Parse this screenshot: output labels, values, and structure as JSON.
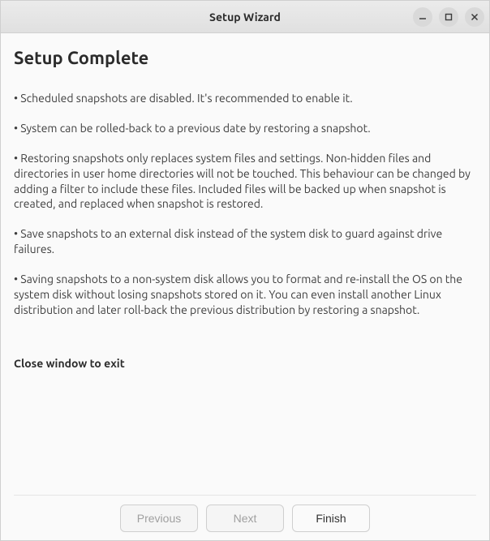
{
  "window": {
    "title": "Setup Wizard"
  },
  "page": {
    "heading": "Setup Complete",
    "bullets": [
      "Scheduled snapshots are disabled. It's recommended to enable it.",
      "System can be rolled-back to a previous date by restoring a snapshot.",
      "Restoring snapshots only replaces system files and settings. Non-hidden files and directories in user home directories will not be touched. This behaviour can be changed by adding a filter to include these files. Included files will be backed up when snapshot is created, and replaced when snapshot is restored.",
      "Save snapshots to an external disk instead of the system disk to guard against drive failures.",
      "Saving snapshots to a non-system disk allows you to format and re-install the OS on the system disk without losing snapshots stored on it. You can even install another Linux distribution and later roll-back the previous distribution by restoring a snapshot."
    ],
    "close_hint": "Close window to exit"
  },
  "footer": {
    "previous": "Previous",
    "next": "Next",
    "finish": "Finish"
  }
}
